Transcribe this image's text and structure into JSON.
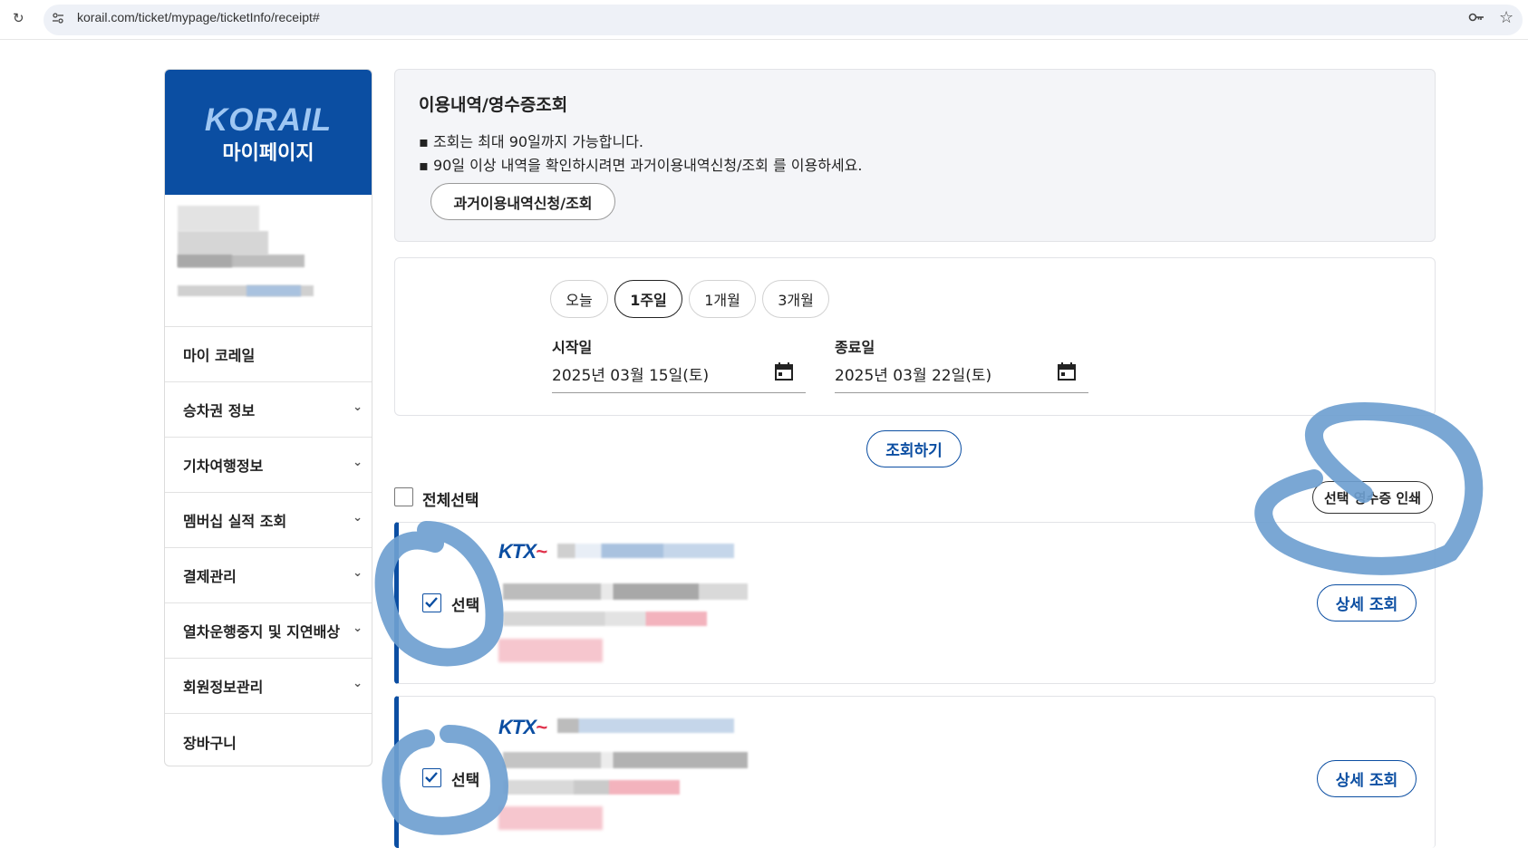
{
  "browser": {
    "url": "korail.com/ticket/mypage/ticketInfo/receipt#"
  },
  "sidebar": {
    "brand_logo": "KORAIL",
    "brand_title": "마이페이지",
    "menu": [
      {
        "label": "마이 코레일",
        "has_chevron": false
      },
      {
        "label": "승차권 정보",
        "has_chevron": true
      },
      {
        "label": "기차여행정보",
        "has_chevron": true
      },
      {
        "label": "멤버십 실적 조회",
        "has_chevron": true
      },
      {
        "label": "결제관리",
        "has_chevron": true
      },
      {
        "label": "열차운행중지 및 지연배상",
        "has_chevron": true
      },
      {
        "label": "회원정보관리",
        "has_chevron": true
      },
      {
        "label": "장바구니",
        "has_chevron": false
      }
    ]
  },
  "info": {
    "title": "이용내역/영수증조회",
    "bullets": [
      "조회는 최대 90일까지 가능합니다.",
      "90일 이상 내역을 확인하시려면 과거이용내역신청/조회 를 이용하세요."
    ],
    "past_button": "과거이용내역신청/조회"
  },
  "period": {
    "options": [
      "오늘",
      "1주일",
      "1개월",
      "3개월"
    ],
    "selected": "1주일",
    "start_label": "시작일",
    "start_value": "2025년 03월 15일(토)",
    "end_label": "종료일",
    "end_value": "2025년 03월 22일(토)"
  },
  "search_button": "조회하기",
  "select_all_label": "전체선택",
  "print_button": "선택 영수증 인쇄",
  "tickets": [
    {
      "brand": "KTX",
      "select_label": "선택",
      "checked": true,
      "detail_button": "상세 조회"
    },
    {
      "brand": "KTX",
      "select_label": "선택",
      "checked": true,
      "detail_button": "상세 조회"
    }
  ],
  "colors": {
    "brand_blue": "#0b4ea2",
    "annotation_blue": "#6f9fd0",
    "ktx_red": "#e0304a"
  }
}
